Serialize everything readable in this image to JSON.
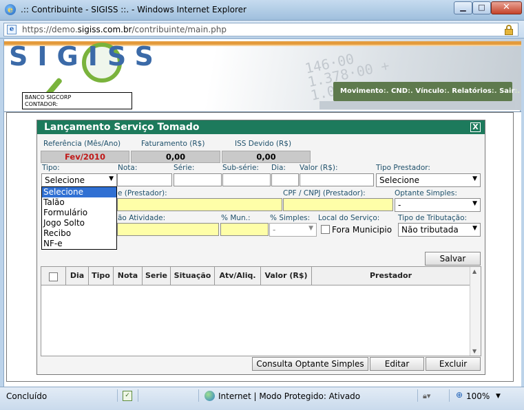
{
  "window": {
    "title": ".:: Contribuinte - SIGISS ::. - Windows Internet Explorer",
    "url_prefix": "https://demo.",
    "url_domain": "sigiss.com.br",
    "url_path": "/contribuinte/main.php"
  },
  "header": {
    "logo": "SIGISS",
    "bank": "BANCO SIGCORP",
    "contador": "CONTADOR:",
    "nav": [
      "Movimento",
      "CND",
      "Vínculo",
      "Relatórios",
      "Sair"
    ],
    "nav_separator": ":."
  },
  "dialog": {
    "title": "Lançamento Serviço Tomado",
    "close": "X",
    "summary": {
      "referencia_label": "Referência (Mês/Ano)",
      "referencia_value": "Fev/2010",
      "faturamento_label": "Faturamento (R$)",
      "faturamento_value": "0,00",
      "iss_label": "ISS Devido (R$)",
      "iss_value": "0,00"
    },
    "row1": {
      "tipo_label": "Tipo:",
      "tipo_value": "Selecione",
      "nota_label": "Nota:",
      "serie_label": "Série:",
      "subserie_label": "Sub-série:",
      "dia_label": "Dia:",
      "valor_label": "Valor (R$):",
      "tipo_prestador_label": "Tipo Prestador:",
      "tipo_prestador_value": "Selecione"
    },
    "row2": {
      "nome_label_visible": "e (Prestador):",
      "cpf_label": "CPF / CNPJ (Prestador):",
      "optante_label": "Optante Simples:",
      "optante_value": "-"
    },
    "row3": {
      "atividade_label_visible": "ão Atividade:",
      "mun_label": "% Mun.:",
      "simples_label": "% Simples:",
      "simples_value": "-",
      "local_label": "Local do Serviço:",
      "fora_label": "Fora Municipio",
      "tributacao_label": "Tipo de Tributação:",
      "tributacao_value": "Não tributada"
    },
    "tipo_options": [
      "Selecione",
      "Talão",
      "Formulário",
      "Jogo Solto",
      "Recibo",
      "NF-e"
    ],
    "salvar": "Salvar",
    "grid_columns": [
      "Dia",
      "Tipo",
      "Nota",
      "Serie",
      "Situação",
      "Atv/Aliq.",
      "Valor (R$)",
      "Prestador"
    ],
    "buttons": {
      "consulta": "Consulta Optante Simples",
      "editar": "Editar",
      "excluir": "Excluir"
    }
  },
  "statusbar": {
    "status": "Concluído",
    "zone": "Internet | Modo Protegido: Ativado",
    "zoom": "100%"
  },
  "colors": {
    "dialog_header": "#1d7a5c",
    "nav_bar": "#5e7a4d",
    "reference_text": "#c01818",
    "highlight_field": "#fefea8",
    "selected_option": "#3070d3"
  }
}
